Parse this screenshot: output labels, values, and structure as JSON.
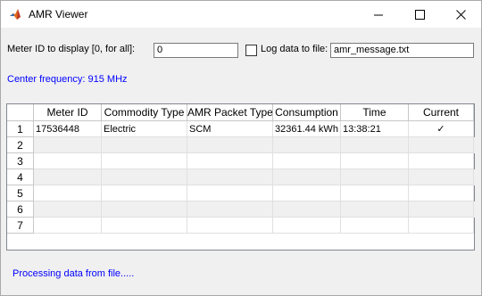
{
  "window": {
    "title": "AMR Viewer",
    "icons": {
      "app": "matlab-icon",
      "minimize": "minimize-icon",
      "maximize": "maximize-icon",
      "close": "close-icon"
    }
  },
  "controls": {
    "meter_label": "Meter ID to display [0, for all]:",
    "meter_value": "0",
    "log_checked": false,
    "log_label": "Log data to file:",
    "file_value": "amr_message.txt",
    "center_frequency": "Center frequency: 915 MHz"
  },
  "table": {
    "columns": [
      "Meter ID",
      "Commodity Type",
      "AMR Packet Type",
      "Consumption",
      "Time",
      "Current"
    ],
    "row_numbers": [
      "1",
      "2",
      "3",
      "4",
      "5",
      "6",
      "7"
    ],
    "rows": [
      [
        "17536448",
        "Electric",
        "SCM",
        "32361.44 kWh",
        "13:38:21",
        "✓"
      ],
      [
        "",
        "",
        "",
        "",
        "",
        ""
      ],
      [
        "",
        "",
        "",
        "",
        "",
        ""
      ],
      [
        "",
        "",
        "",
        "",
        "",
        ""
      ],
      [
        "",
        "",
        "",
        "",
        "",
        ""
      ],
      [
        "",
        "",
        "",
        "",
        "",
        ""
      ],
      [
        "",
        "",
        "",
        "",
        "",
        ""
      ]
    ]
  },
  "status": "Processing data from file.....",
  "colors": {
    "status_text": "#0000ff",
    "alt_row": "#f0f0f0"
  }
}
